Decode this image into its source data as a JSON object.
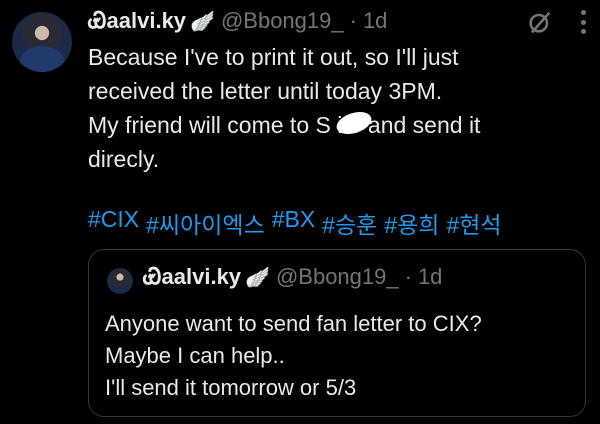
{
  "tweet": {
    "author_name": "Ꮿaalvi.ky",
    "author_badge": "🪽",
    "handle": "@Bbong19_",
    "separator": "·",
    "time": "1d",
    "text": "Because I've to print it out, so I'll just\nreceived the letter until today 3PM.\nMy friend will come to S   it9 and send it\ndirecly.",
    "hashtags": [
      "#CIX",
      "#씨아이엑스",
      "#BX",
      "#승훈",
      "#용희",
      "#현석"
    ],
    "icons": {
      "grok": "grok-icon",
      "more": "more-icon"
    }
  },
  "quote": {
    "author_name": "Ꮿaalvi.ky",
    "author_badge": "🪽",
    "handle": "@Bbong19_",
    "separator": "·",
    "time": "1d",
    "text": "Anyone want to send fan letter to CIX?\nMaybe I can help..\nI'll send it tomorrow or 5/3"
  },
  "colors": {
    "background": "#000000",
    "text": "#e7e9ea",
    "muted": "#71767b",
    "link": "#1d9bf0",
    "border": "#333639"
  }
}
